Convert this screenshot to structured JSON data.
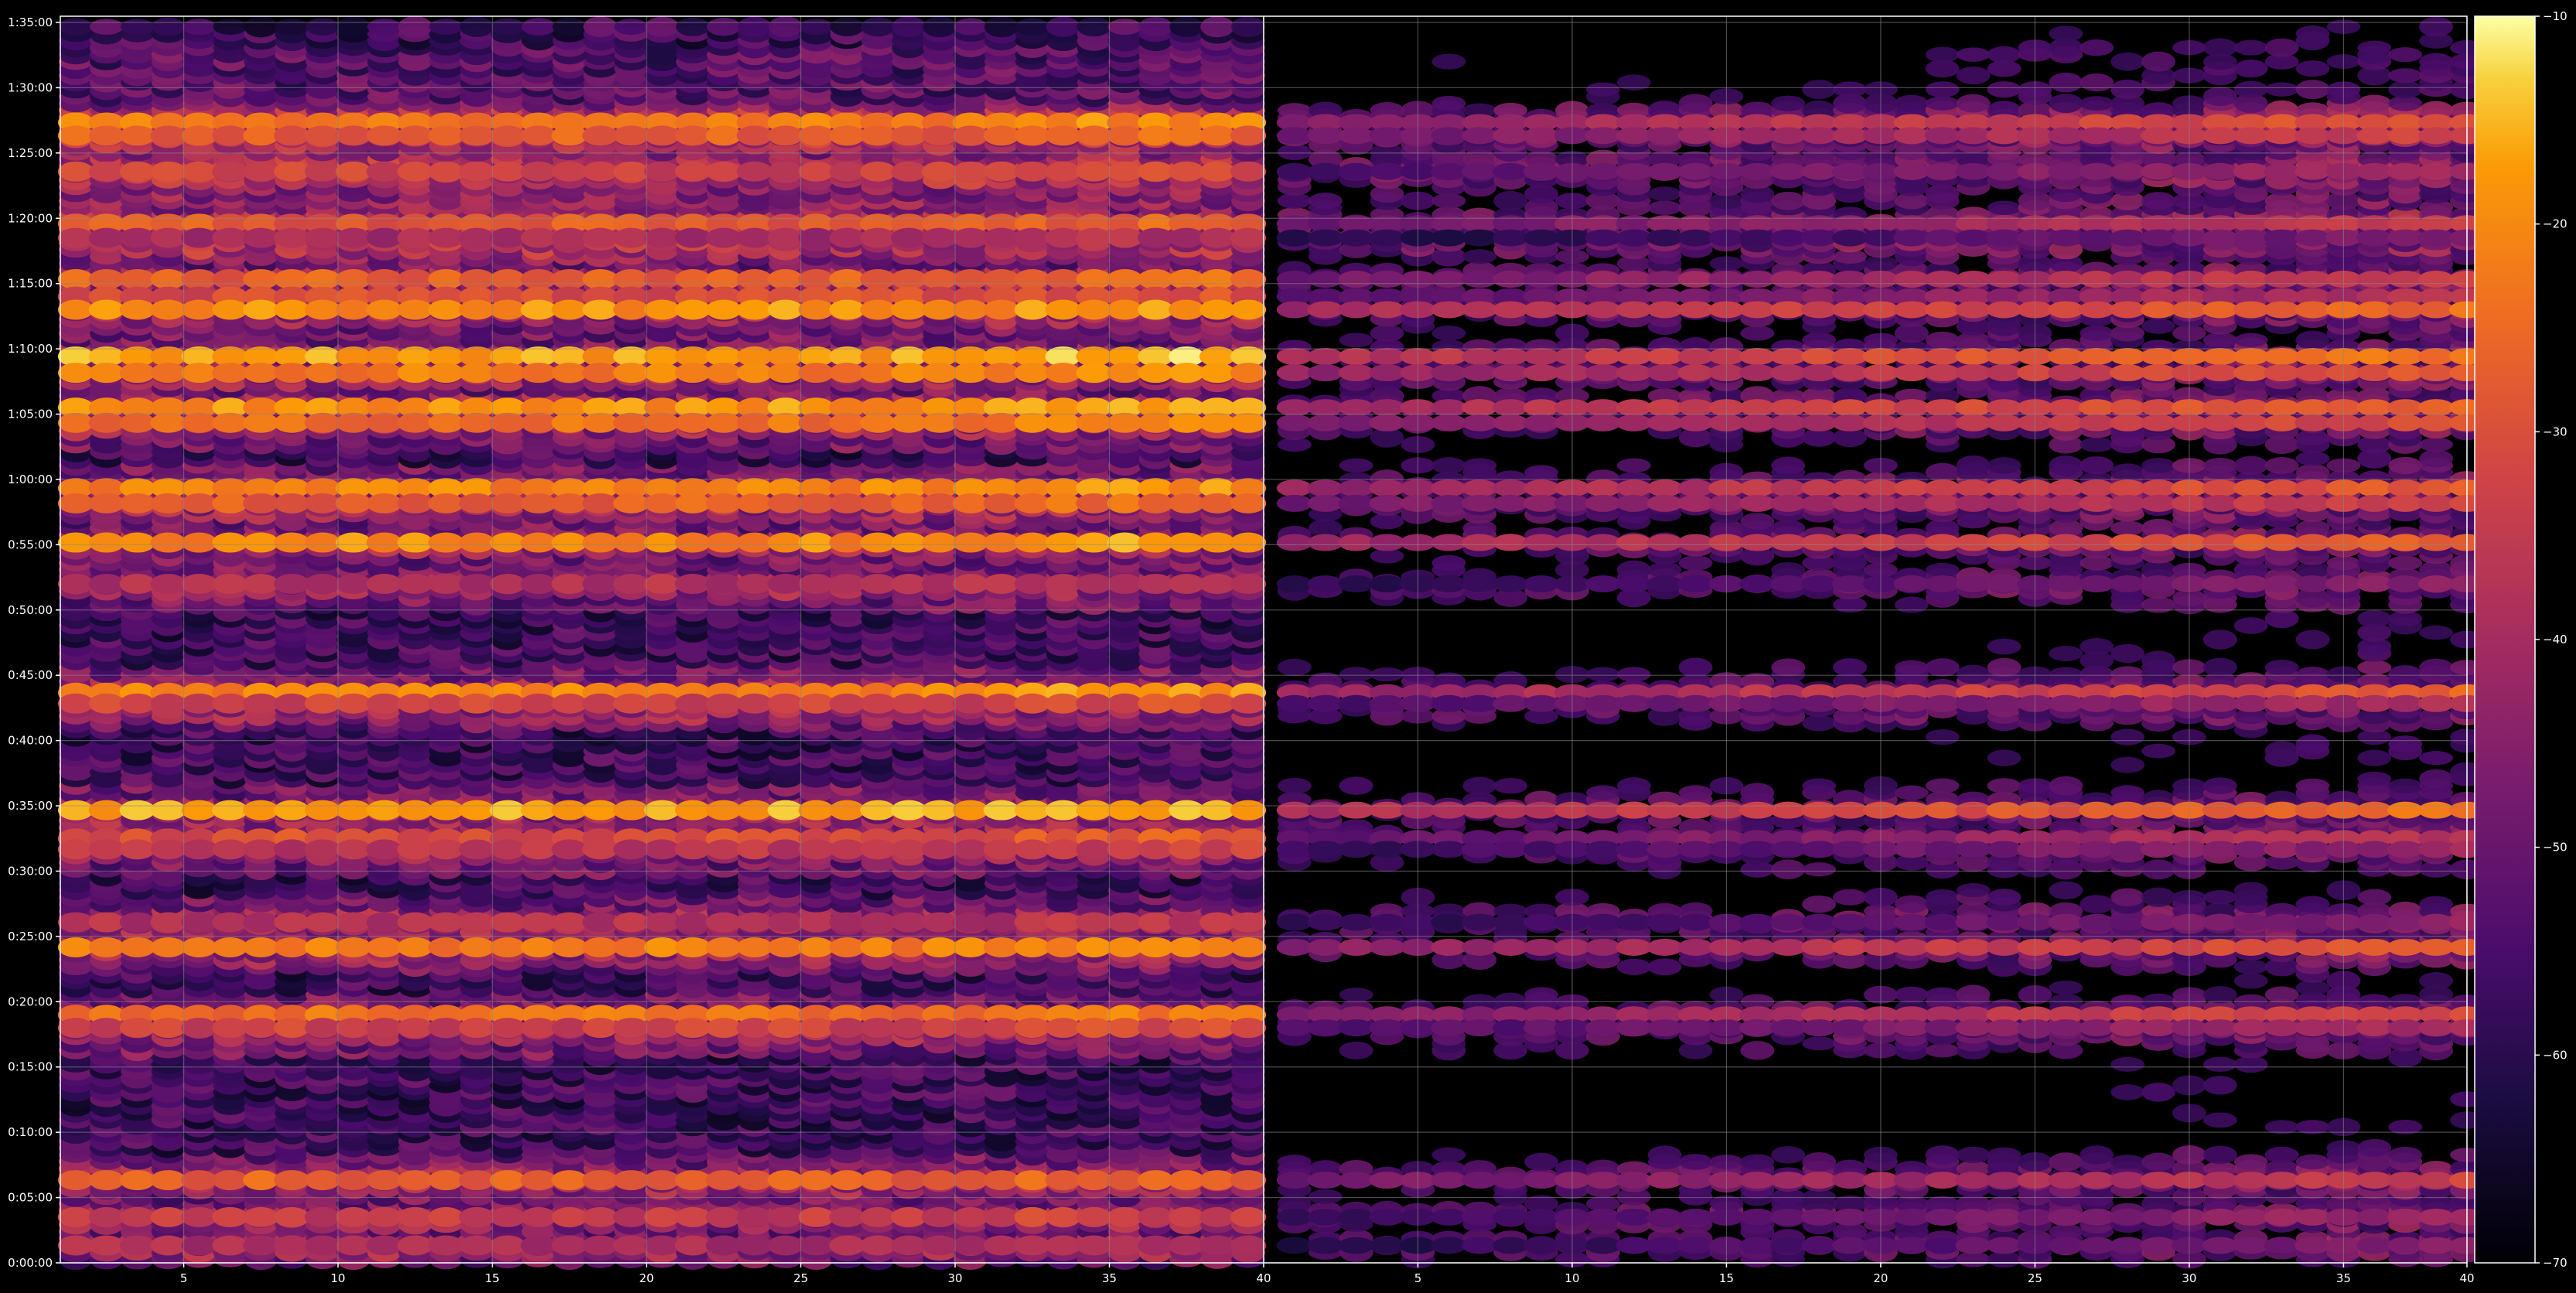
{
  "chart_data": {
    "type": "heatmap",
    "title": "",
    "xlabel": "",
    "ylabel": "",
    "colormap": "inferno",
    "background": "#000000",
    "grid": true,
    "panels": [
      {
        "x_range": [
          1,
          40
        ],
        "x_ticks": [
          5,
          10,
          15,
          20,
          25,
          30,
          35,
          40
        ],
        "x_tick_labels": [
          "5",
          "10",
          "15",
          "20",
          "25",
          "30",
          "35",
          "40"
        ],
        "intensity": "strong"
      },
      {
        "x_range": [
          40,
          79
        ],
        "x_ticks": [
          45,
          50,
          55,
          60,
          65,
          70,
          75,
          79
        ],
        "x_tick_labels": [
          "5",
          "10",
          "15",
          "20",
          "25",
          "30",
          "35",
          "40"
        ],
        "intensity": "attenuated"
      }
    ],
    "y_axis": {
      "range_seconds": [
        0,
        5700
      ],
      "tick_seconds": [
        0,
        300,
        600,
        900,
        1200,
        1500,
        1800,
        2100,
        2400,
        2700,
        3000,
        3300,
        3600,
        3900,
        4200,
        4500,
        4800,
        5100,
        5400,
        5700
      ],
      "tick_labels": [
        "0:00:00",
        "0:05:00",
        "0:10:00",
        "0:15:00",
        "0:20:00",
        "0:25:00",
        "0:30:00",
        "0:35:00",
        "0:40:00",
        "0:45:00",
        "0:50:00",
        "0:55:00",
        "1:00:00",
        "1:05:00",
        "1:10:00",
        "1:15:00",
        "1:20:00",
        "1:25:00",
        "1:30:00",
        "1:35:00"
      ]
    },
    "colorbar": {
      "range": [
        -70,
        -10
      ],
      "ticks": [
        -70,
        -60,
        -50,
        -40,
        -30,
        -20,
        -10
      ],
      "tick_labels": [
        "−70",
        "−60",
        "−50",
        "−40",
        "−30",
        "−20",
        "−10"
      ]
    },
    "bands": [
      {
        "t": 5240,
        "value": -22
      },
      {
        "t": 5180,
        "value": -27
      },
      {
        "t": 5015,
        "value": -33
      },
      {
        "t": 4775,
        "value": -28
      },
      {
        "t": 4710,
        "value": -40
      },
      {
        "t": 4520,
        "value": -27
      },
      {
        "t": 4440,
        "value": -31
      },
      {
        "t": 4380,
        "value": -19
      },
      {
        "t": 4165,
        "value": -17
      },
      {
        "t": 4090,
        "value": -22
      },
      {
        "t": 3930,
        "value": -19
      },
      {
        "t": 3860,
        "value": -24
      },
      {
        "t": 3560,
        "value": -21
      },
      {
        "t": 3490,
        "value": -27
      },
      {
        "t": 3310,
        "value": -20
      },
      {
        "t": 3120,
        "value": -38
      },
      {
        "t": 2620,
        "value": -21
      },
      {
        "t": 2570,
        "value": -33
      },
      {
        "t": 2080,
        "value": -17
      },
      {
        "t": 1950,
        "value": -30
      },
      {
        "t": 1900,
        "value": -36
      },
      {
        "t": 1565,
        "value": -38
      },
      {
        "t": 1450,
        "value": -22
      },
      {
        "t": 1140,
        "value": -24
      },
      {
        "t": 1080,
        "value": -33
      },
      {
        "t": 380,
        "value": -27
      },
      {
        "t": 210,
        "value": -35
      },
      {
        "t": 80,
        "value": -39
      }
    ]
  }
}
